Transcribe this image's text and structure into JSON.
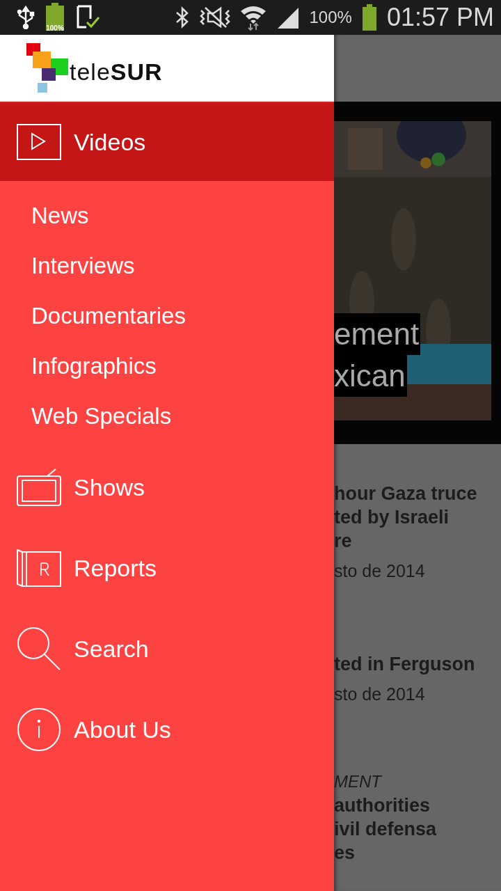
{
  "status_bar": {
    "battery_small_label": "100%",
    "battery_percent": "100%",
    "time": "01:57 PM"
  },
  "drawer": {
    "logo": {
      "light": "tele",
      "bold": "SUR"
    },
    "sections": [
      {
        "kind": "play",
        "label": "Videos",
        "selected": true,
        "children": [
          {
            "label": "News"
          },
          {
            "label": "Interviews"
          },
          {
            "label": "Documentaries"
          },
          {
            "label": "Infographics"
          },
          {
            "label": "Web Specials"
          }
        ]
      },
      {
        "kind": "tv",
        "label": "Shows",
        "selected": false
      },
      {
        "kind": "report",
        "label": "Reports",
        "selected": false
      },
      {
        "kind": "search",
        "label": "Search",
        "selected": false
      },
      {
        "kind": "info",
        "label": "About Us",
        "selected": false
      }
    ]
  },
  "background": {
    "video": {
      "kind": "picture",
      "caption_lines": [
        "ement",
        "xican"
      ]
    },
    "articles": [
      {
        "title_lines": [
          "hour Gaza truce",
          "ted by Israeli",
          "re"
        ],
        "date": "sto de 2014"
      },
      {
        "title_lines": [
          "ted in Ferguson"
        ],
        "date": "sto de 2014"
      },
      {
        "category": "MENT",
        "title_lines": [
          "authorities",
          "ivil defensa",
          "es"
        ]
      }
    ]
  }
}
